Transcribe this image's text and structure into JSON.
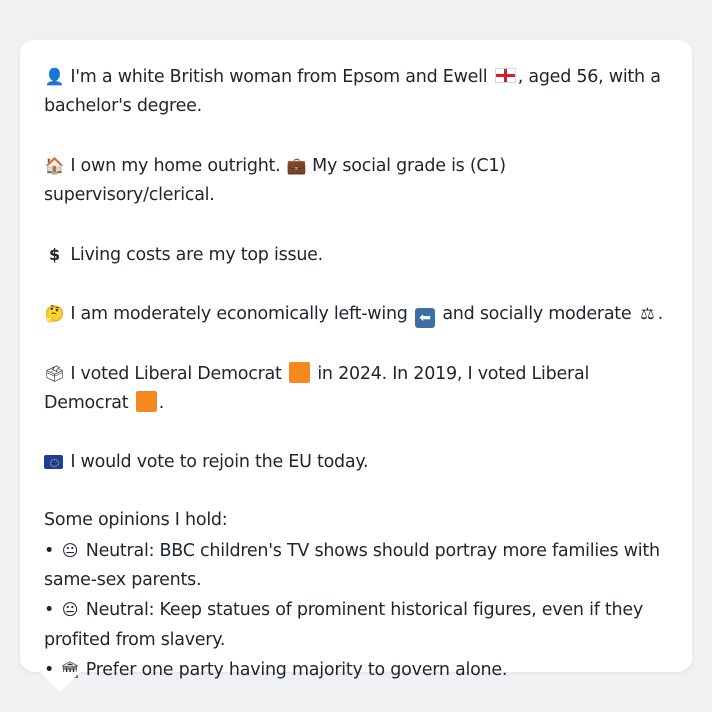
{
  "profile": {
    "intro": {
      "icon": "bust-in-silhouette-icon",
      "text_before_flag": "I'm a white British woman from Epsom and Ewell",
      "flag_icon": "england-flag-icon",
      "text_after_flag": ", aged 56, with a bachelor's degree."
    },
    "housing": {
      "icon": "house-icon",
      "text": "I own my home outright.",
      "grade_icon": "briefcase-icon",
      "grade_text": "My social grade is (C1) supervisory/clerical."
    },
    "issue": {
      "icon": "dollar-sign-icon",
      "text": "Living costs are my top issue."
    },
    "ideology": {
      "icon": "thinking-face-icon",
      "text_before_arrow": "I am moderately economically left-wing",
      "arrow_icon": "left-arrow-icon",
      "text_after_arrow": "and socially moderate",
      "scales_icon": "balance-scale-icon",
      "end": "."
    },
    "voting": {
      "icon": "ballot-box-icon",
      "text_2024": "I voted Liberal Democrat",
      "party_icon": "orange-square-icon",
      "party_color": "#f5891f",
      "text_2019": "in 2024. In 2019, I voted Liberal Democrat",
      "end": "."
    },
    "eu": {
      "icon": "eu-flag-icon",
      "text": "I would vote to rejoin the EU today."
    },
    "opinions_heading": "Some opinions I hold:",
    "opinions": [
      {
        "bullet": "•",
        "icon": "neutral-face-icon",
        "text": "Neutral: BBC children's TV shows should portray more families with same-sex parents."
      },
      {
        "bullet": "•",
        "icon": "neutral-face-icon",
        "text": "Neutral: Keep statues of prominent historical figures, even if they profited from slavery."
      },
      {
        "bullet": "•",
        "icon": "classical-building-icon",
        "text": "Prefer one party having majority to govern alone."
      }
    ]
  },
  "colors": {
    "background": "#eff1f3",
    "card": "#ffffff",
    "text": "#1f2530",
    "liberal_democrat": "#f5891f",
    "eu_blue": "#1f3c9a"
  }
}
